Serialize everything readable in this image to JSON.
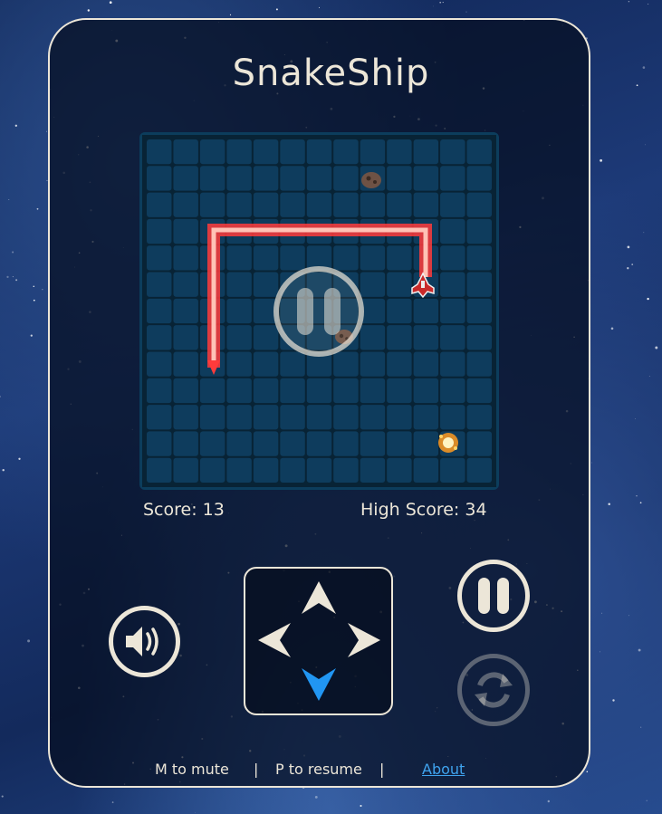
{
  "game": {
    "title": "SnakeShip"
  },
  "board": {
    "columns": 13,
    "rows": 13,
    "cell_color": "#0e3c5d",
    "grid_line_color": "#082335",
    "snake_color": "#ff3b3b",
    "snake_glow": "#ffd0c8",
    "overlay_state": "paused"
  },
  "score": {
    "score_text": "Score: 13",
    "high_score_text": "High Score: 34"
  },
  "controls": {
    "mute_icon": "speaker-icon",
    "pause_icon": "pause-icon",
    "restart_icon": "restart-icon",
    "active_direction": "down",
    "active_color": "#2196f3",
    "inactive_color": "#ece6d8"
  },
  "footer": {
    "mute_hint": "M to mute",
    "separator1": "|",
    "resume_hint": "P to resume",
    "separator2": "|",
    "about_link": "About"
  }
}
